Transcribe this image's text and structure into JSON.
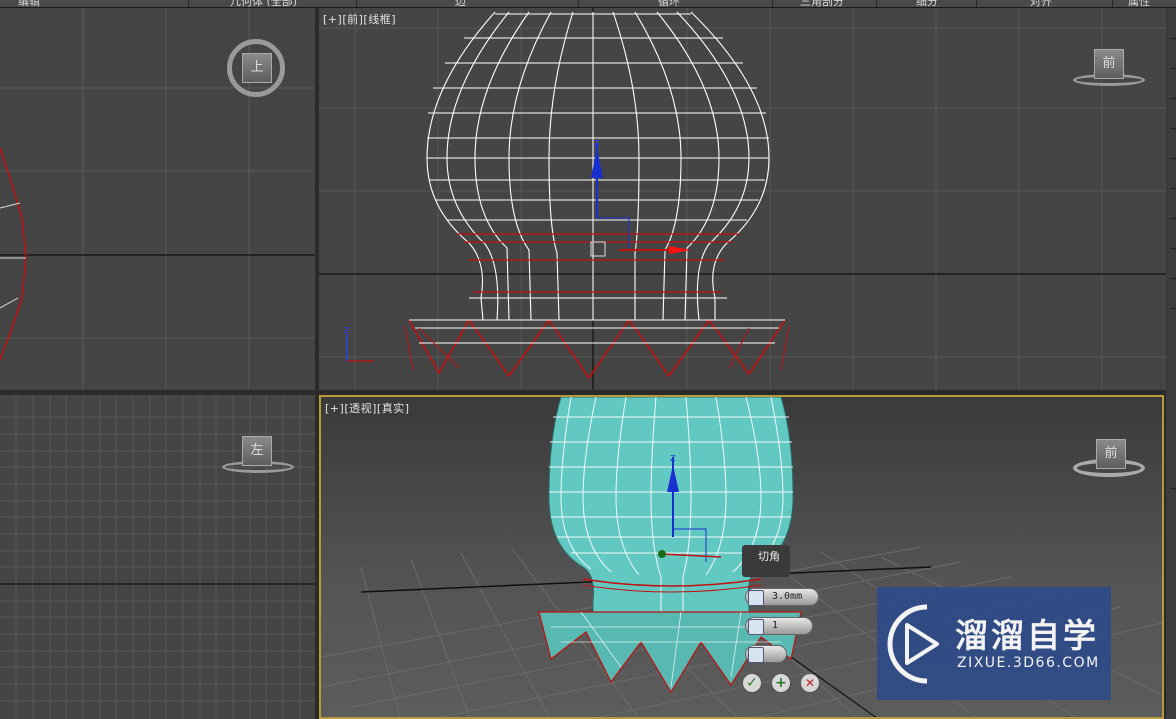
{
  "menu": {
    "items": [
      "编辑",
      "几何体 (全部)",
      "边",
      "循环",
      "三角剖分",
      "细分",
      "对齐",
      "属性"
    ]
  },
  "viewports": {
    "top_left": {
      "cube_label": "上"
    },
    "front": {
      "labels": [
        "[+]",
        "[前]",
        "[线框]"
      ],
      "cube_label": "前"
    },
    "left": {
      "cube_label": "左"
    },
    "perspective": {
      "labels": [
        "[+]",
        "[透视]",
        "[真实]"
      ],
      "cube_label": "前"
    }
  },
  "caddy": {
    "title": "切角",
    "amount": "3.0mm",
    "segments": "1",
    "ok_symbol": "✓",
    "apply_symbol": "+",
    "cancel_symbol": "✕"
  },
  "watermark": {
    "title": "溜溜自学",
    "subtitle": "ZIXUE.3D66.COM"
  },
  "colors": {
    "viewport_bg": "#454545",
    "active_border": "#b79a3a",
    "wire_white": "#ffffff",
    "selection_red": "#cc1111",
    "mesh_cyan": "#62c9c2"
  }
}
